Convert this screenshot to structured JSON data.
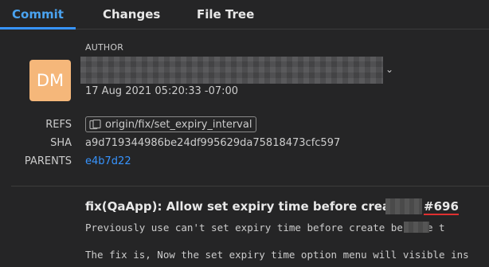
{
  "tabs": [
    {
      "label": "Commit",
      "active": true
    },
    {
      "label": "Changes",
      "active": false
    },
    {
      "label": "File Tree",
      "active": false
    }
  ],
  "author": {
    "heading": "AUTHOR",
    "avatar_initials": "DM",
    "avatar_color": "#f5b77a",
    "date": "17 Aug 2021 05:20:33 -07:00"
  },
  "meta": {
    "refs_label": "REFS",
    "ref_name": "origin/fix/set_expiry_interval",
    "sha_label": "SHA",
    "sha_value": "a9d719344986be24df995629da75818473cfc597",
    "parents_label": "PARENTS",
    "parent_value": "e4b7d22"
  },
  "message": {
    "title": "fix(QaApp): Allow set expiry time before create",
    "issue": "#696",
    "line1": "Previously use can't set expiry time before create       because t",
    "line2": "The fix is, Now the set expiry time option menu will visible ins"
  },
  "colors": {
    "accent": "#3794ff",
    "issue_underline": "#e03030"
  }
}
